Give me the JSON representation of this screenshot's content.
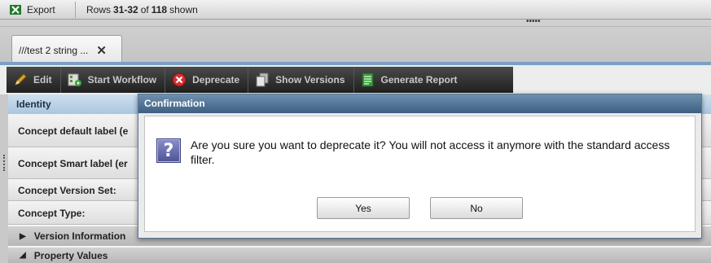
{
  "topbar": {
    "export_label": "Export",
    "rows_prefix": "Rows",
    "rows_range": "31-32",
    "rows_of": "of",
    "rows_total": "118",
    "rows_suffix": "shown",
    "splitter_dots": "•••••"
  },
  "tab": {
    "label": "///test 2 string ...",
    "close": "✕"
  },
  "toolbar": {
    "buttons": [
      {
        "label": "Edit",
        "icon": "pencil-icon"
      },
      {
        "label": "Start Workflow",
        "icon": "workflow-icon"
      },
      {
        "label": "Deprecate",
        "icon": "deprecate-icon"
      },
      {
        "label": "Show Versions",
        "icon": "versions-icon"
      },
      {
        "label": "Generate Report",
        "icon": "report-icon"
      }
    ]
  },
  "panel": {
    "identity_header": "Identity",
    "rows": [
      "Concept default label (e",
      "Concept Smart label (er",
      "Concept Version Set:",
      "Concept Type:"
    ],
    "sections": [
      {
        "label": "Version Information",
        "arrow": "▶"
      },
      {
        "label": "Property Values",
        "arrow": "◢"
      }
    ]
  },
  "dialog": {
    "title": "Confirmation",
    "icon": "question-icon",
    "icon_glyph": "?",
    "message": "Are you sure you want to deprecate it? You will not access it anymore with the standard access filter.",
    "yes_label": "Yes",
    "no_label": "No"
  },
  "colors": {
    "dialog_title": "#4d6e8f",
    "toolbar_bg": "#2e2e2e",
    "identity_header": "#b9d1e6",
    "question_icon": "#5a60a8"
  }
}
